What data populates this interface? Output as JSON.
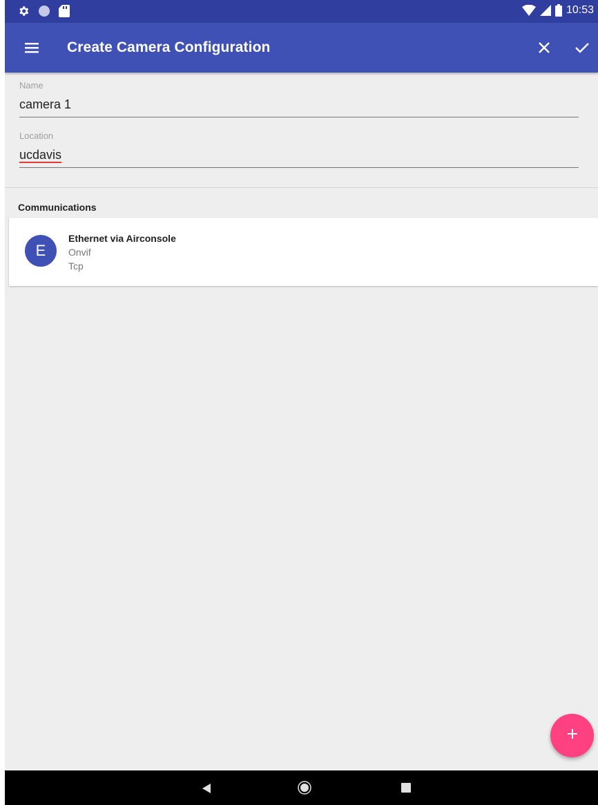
{
  "status_bar": {
    "time": "10:53",
    "left_icons": [
      "settings-icon",
      "circle-icon",
      "sd-card-icon"
    ],
    "right_icons": [
      "wifi-icon",
      "signal-icon",
      "battery-icon"
    ]
  },
  "app_bar": {
    "title": "Create Camera Configuration",
    "background": "#3f51b5",
    "status_background": "#303f9f",
    "actions": [
      "close-icon",
      "check-icon"
    ]
  },
  "form": {
    "name": {
      "label": "Name",
      "value": "camera 1"
    },
    "location": {
      "label": "Location",
      "value": "ucdavis"
    }
  },
  "communications": {
    "header": "Communications",
    "items": [
      {
        "avatar_letter": "E",
        "title": "Ethernet via Airconsole",
        "line2": "Onvif",
        "line3": "Tcp"
      }
    ]
  },
  "fab": {
    "icon": "plus-icon",
    "color": "#ff4081"
  },
  "nav_bar": {
    "buttons": [
      "back-icon",
      "home-icon",
      "recents-icon"
    ]
  }
}
